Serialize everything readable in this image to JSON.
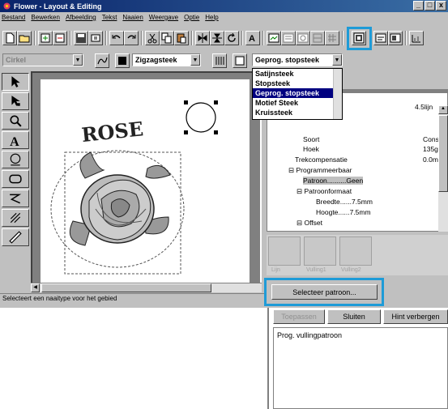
{
  "window": {
    "title": "Flower - Layout & Editing",
    "controls": [
      "_",
      "□",
      "x"
    ]
  },
  "menu": [
    "Bestand",
    "Bewerken",
    "Afbeelding",
    "Tekst",
    "Naaien",
    "Weergave",
    "Optie",
    "Help"
  ],
  "toolbar2": {
    "shape_combo": "Cirkel",
    "stitch_combo": "Zigzagsteek",
    "fill_combo": "Geprog. stopsteek"
  },
  "dropdown": {
    "items": [
      "Satijnsteek",
      "Stopsteek",
      "Geprog. stopsteek",
      "Motief Steek",
      "Kruissteek"
    ],
    "selected": "Geprog. stopsteek"
  },
  "canvas": {
    "text": "ROSE"
  },
  "status": "Selecteert een naaitype voor het gebied",
  "tree": {
    "width_value": "4.5lijn",
    "soort": "Soort",
    "soort_val": "Cons",
    "hoek": "Hoek",
    "hoek_val": "135gr",
    "trek": "Trekcompensatie",
    "trek_val": "0.0mr",
    "prog": "Programmeerbaar",
    "patroon": "Patroon..........Geen",
    "patroonformaat": "Patroonformaat",
    "breedte": "Breedte......7.5mm",
    "hoogte": "Hoogte......7.5mm",
    "offset": "Offset"
  },
  "patterns": [
    "Lijn",
    "Vulling1",
    "Vulling2"
  ],
  "buttons": {
    "select_pattern": "Selecteer patroon...",
    "apply": "Toepassen",
    "close": "Sluiten",
    "hint": "Hint verbergen"
  },
  "hint_text": "Prog. vullingpatroon",
  "colors": {
    "highlight": "#1e9bd7",
    "titlebar": "#0a246a",
    "selection": "#000080"
  }
}
